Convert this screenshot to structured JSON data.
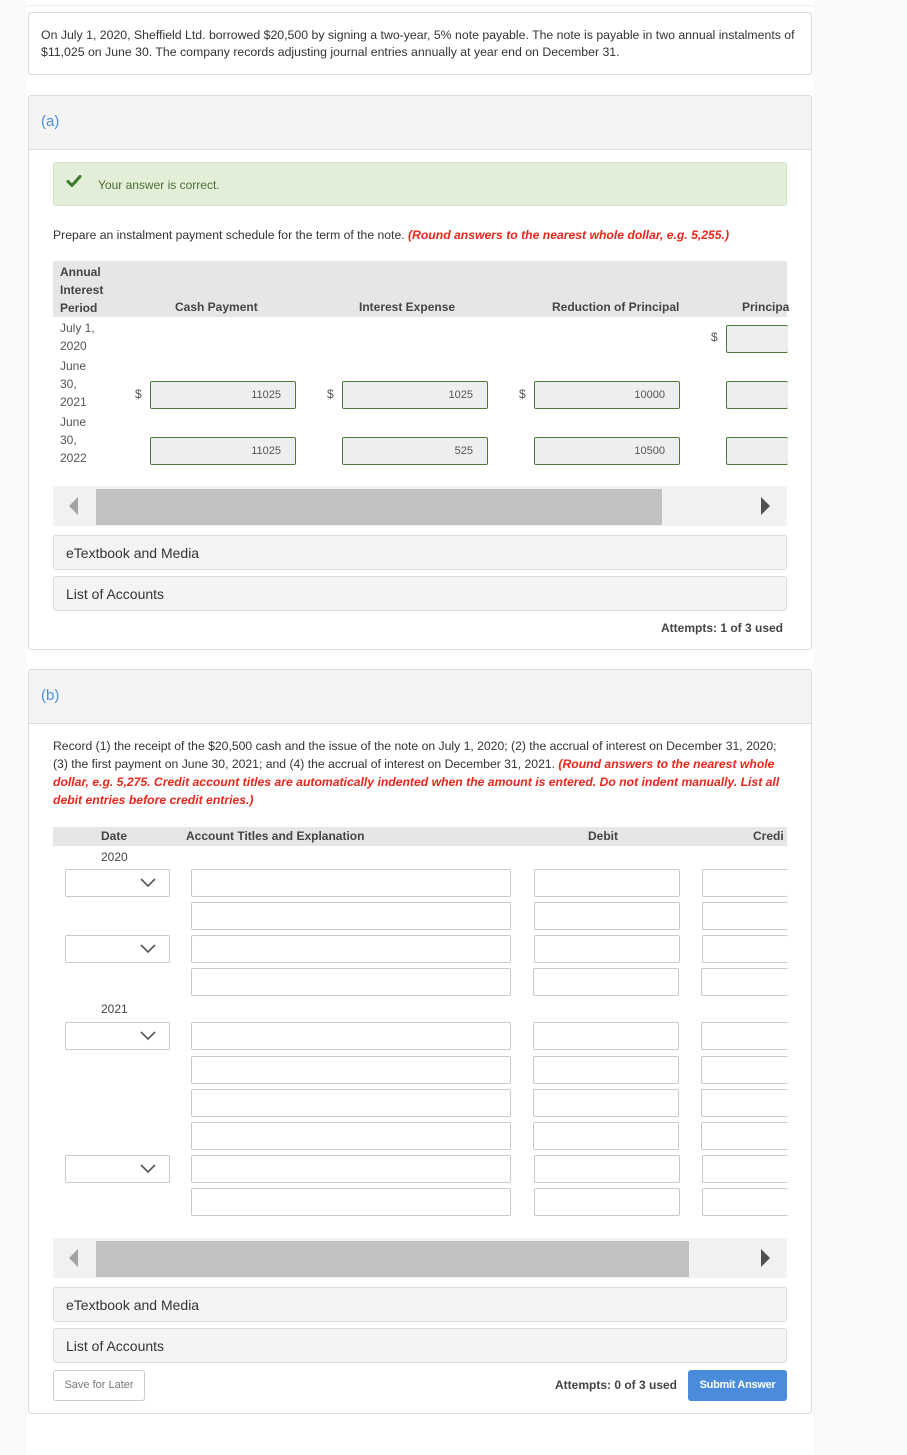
{
  "problem": {
    "text": "On July 1, 2020, Sheffield Ltd. borrowed $20,500 by signing a two-year, 5% note payable. The note is payable in two annual instalments of $11,025 on June 30. The company records adjusting journal entries annually at year end on December 31."
  },
  "part_a": {
    "label": "(a)",
    "status": {
      "icon": "check-icon",
      "text": "Your answer is correct.",
      "color": "#4a6e36"
    },
    "instruction": "Prepare an instalment payment schedule for the term of the note.",
    "hint": "(Round answers to the nearest whole dollar, e.g. 5,255.)",
    "table": {
      "headers": {
        "period": [
          "Annual",
          "Interest",
          "Period"
        ],
        "cash_payment": "Cash Payment",
        "interest_expense": "Interest Expense",
        "reduction_principal": "Reduction of Principal",
        "principal_balance": "Principa"
      },
      "currency_symbol": "$",
      "rows": [
        {
          "period": [
            "July 1,",
            "2020"
          ],
          "cash_payment": null,
          "interest_expense": null,
          "reduction_principal": null,
          "principal_balance": ""
        },
        {
          "period": [
            "June",
            "30,",
            "2021"
          ],
          "cash_payment": "11025",
          "interest_expense": "1025",
          "reduction_principal": "10000",
          "principal_balance": ""
        },
        {
          "period": [
            "June",
            "30,",
            "2022"
          ],
          "cash_payment": "11025",
          "interest_expense": "525",
          "reduction_principal": "10500",
          "principal_balance": ""
        }
      ]
    },
    "links": {
      "etextbook": "eTextbook and Media",
      "list_of_accounts": "List of Accounts"
    },
    "attempts": "Attempts: 1 of 3 used"
  },
  "part_b": {
    "label": "(b)",
    "instruction": "Record (1) the receipt of the $20,500 cash and the issue of the note on July 1, 2020; (2) the accrual of interest on December 31, 2020; (3) the first payment on June 30, 2021; and (4) the accrual of interest on December 31, 2021.",
    "hint": "(Round answers to the nearest whole dollar, e.g. 5,275. Credit account titles are automatically indented when the amount is entered. Do not indent manually. List all debit entries before credit entries.)",
    "journal": {
      "headers": {
        "date": "Date",
        "account": "Account Titles and Explanation",
        "debit": "Debit",
        "credit": "Credi"
      },
      "years": [
        "2020",
        "2021"
      ],
      "date_selected": [
        "",
        "",
        "",
        ""
      ]
    },
    "links": {
      "etextbook": "eTextbook and Media",
      "list_of_accounts": "List of Accounts"
    },
    "buttons": {
      "save": "Save for Later",
      "submit": "Submit Answer"
    },
    "attempts": "Attempts: 0 of 3 used",
    "accent_color": "#4a8cdb"
  }
}
